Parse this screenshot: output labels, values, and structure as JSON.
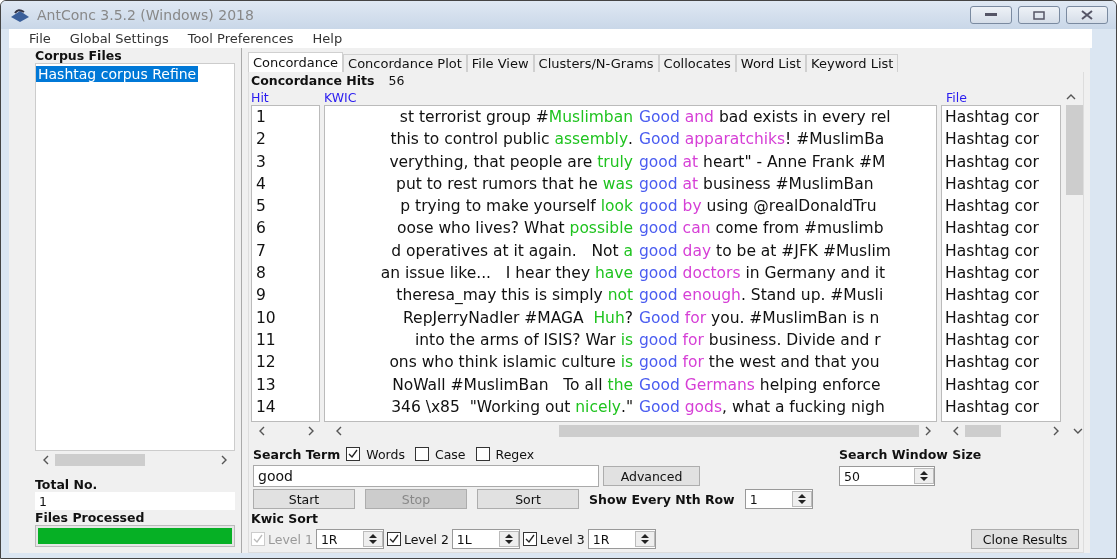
{
  "window": {
    "title": "AntConc 3.5.2 (Windows) 2018"
  },
  "menu": [
    "File",
    "Global Settings",
    "Tool Preferences",
    "Help"
  ],
  "corpus_files": {
    "label": "Corpus Files",
    "files": [
      {
        "name": "Hashtag corpus Refine",
        "selected": true
      }
    ]
  },
  "total_no": {
    "label": "Total No.",
    "value": "1"
  },
  "files_processed": {
    "label": "Files Processed",
    "level": 1
  },
  "tabs": [
    {
      "label": "Concordance",
      "selected": true
    },
    {
      "label": "Concordance Plot",
      "selected": false
    },
    {
      "label": "File View",
      "selected": false
    },
    {
      "label": "Clusters/N-Grams",
      "selected": false
    },
    {
      "label": "Collocates",
      "selected": false
    },
    {
      "label": "Word List",
      "selected": false
    },
    {
      "label": "Keyword List",
      "selected": false
    }
  ],
  "hits": {
    "label": "Concordance Hits",
    "value": "56"
  },
  "table": {
    "columns": [
      "Hit",
      "KWIC",
      "File"
    ],
    "rows": [
      {
        "hit": "1",
        "left": [
          {
            "kind": "plain",
            "text": "st terrorist group #"
          },
          {
            "kind": "collocate",
            "text": "Muslimban"
          }
        ],
        "node": "Good",
        "right": [
          {
            "kind": "collocate",
            "text": "and"
          },
          {
            "kind": "plain",
            "text": " bad exists in every rel"
          }
        ],
        "file": "Hashtag cor"
      },
      {
        "hit": "2",
        "left": [
          {
            "kind": "plain",
            "text": "this to control public "
          },
          {
            "kind": "collocate",
            "text": "assembly"
          },
          {
            "kind": "plain",
            "text": "."
          }
        ],
        "node": "Good",
        "right": [
          {
            "kind": "collocate",
            "text": "apparatchiks"
          },
          {
            "kind": "plain",
            "text": "! #MuslimBa"
          }
        ],
        "file": "Hashtag cor"
      },
      {
        "hit": "3",
        "left": [
          {
            "kind": "plain",
            "text": "verything, that people are "
          },
          {
            "kind": "collocate",
            "text": "truly"
          }
        ],
        "node": "good",
        "right": [
          {
            "kind": "collocate",
            "text": "at"
          },
          {
            "kind": "plain",
            "text": " heart\" - Anne Frank #M"
          }
        ],
        "file": "Hashtag cor"
      },
      {
        "hit": "4",
        "left": [
          {
            "kind": "plain",
            "text": "put to rest rumors that he "
          },
          {
            "kind": "collocate",
            "text": "was"
          }
        ],
        "node": "good",
        "right": [
          {
            "kind": "collocate",
            "text": "at"
          },
          {
            "kind": "plain",
            "text": " business #MuslimBan"
          }
        ],
        "file": "Hashtag cor"
      },
      {
        "hit": "5",
        "left": [
          {
            "kind": "plain",
            "text": "p trying to make yourself "
          },
          {
            "kind": "collocate",
            "text": "look"
          }
        ],
        "node": "good",
        "right": [
          {
            "kind": "collocate",
            "text": "by"
          },
          {
            "kind": "plain",
            "text": " using @realDonaldTru"
          }
        ],
        "file": "Hashtag cor"
      },
      {
        "hit": "6",
        "left": [
          {
            "kind": "plain",
            "text": "oose who lives? What "
          },
          {
            "kind": "collocate",
            "text": "possible"
          }
        ],
        "node": "good",
        "right": [
          {
            "kind": "collocate",
            "text": "can"
          },
          {
            "kind": "plain",
            "text": " come from #muslimb"
          }
        ],
        "file": "Hashtag cor"
      },
      {
        "hit": "7",
        "left": [
          {
            "kind": "plain",
            "text": "d operatives at it again.   Not "
          },
          {
            "kind": "collocate",
            "text": "a"
          }
        ],
        "node": "good",
        "right": [
          {
            "kind": "collocate",
            "text": "day"
          },
          {
            "kind": "plain",
            "text": " to be at #JFK #Muslim"
          }
        ],
        "file": "Hashtag cor"
      },
      {
        "hit": "8",
        "left": [
          {
            "kind": "plain",
            "text": "an issue like...   I hear they "
          },
          {
            "kind": "collocate",
            "text": "have"
          }
        ],
        "node": "good",
        "right": [
          {
            "kind": "collocate",
            "text": "doctors"
          },
          {
            "kind": "plain",
            "text": " in Germany and it"
          }
        ],
        "file": "Hashtag cor"
      },
      {
        "hit": "9",
        "left": [
          {
            "kind": "plain",
            "text": "theresa_may this is simply "
          },
          {
            "kind": "collocate",
            "text": "not"
          }
        ],
        "node": "good",
        "right": [
          {
            "kind": "collocate",
            "text": "enough"
          },
          {
            "kind": "plain",
            "text": ". Stand up. #Musli"
          }
        ],
        "file": "Hashtag cor"
      },
      {
        "hit": "10",
        "left": [
          {
            "kind": "plain",
            "text": "RepJerryNadler #MAGA  "
          },
          {
            "kind": "collocate",
            "text": "Huh"
          },
          {
            "kind": "plain",
            "text": "?"
          }
        ],
        "node": "Good",
        "right": [
          {
            "kind": "collocate",
            "text": "for"
          },
          {
            "kind": "plain",
            "text": " you. #MuslimBan is n"
          }
        ],
        "file": "Hashtag cor"
      },
      {
        "hit": "11",
        "left": [
          {
            "kind": "plain",
            "text": "into the arms of ISIS? War "
          },
          {
            "kind": "collocate",
            "text": "is"
          }
        ],
        "node": "good",
        "right": [
          {
            "kind": "collocate",
            "text": "for"
          },
          {
            "kind": "plain",
            "text": " business. Divide and r"
          }
        ],
        "file": "Hashtag cor"
      },
      {
        "hit": "12",
        "left": [
          {
            "kind": "plain",
            "text": "ons who think islamic culture "
          },
          {
            "kind": "collocate",
            "text": "is"
          }
        ],
        "node": "good",
        "right": [
          {
            "kind": "collocate",
            "text": "for"
          },
          {
            "kind": "plain",
            "text": " the west and that you"
          }
        ],
        "file": "Hashtag cor"
      },
      {
        "hit": "13",
        "left": [
          {
            "kind": "plain",
            "text": "NoWall #MuslimBan   To all "
          },
          {
            "kind": "collocate",
            "text": "the"
          }
        ],
        "node": "Good",
        "right": [
          {
            "kind": "collocate",
            "text": "Germans"
          },
          {
            "kind": "plain",
            "text": " helping enforce"
          }
        ],
        "file": "Hashtag cor"
      },
      {
        "hit": "14",
        "left": [
          {
            "kind": "plain",
            "text": "346 \\x85  \"Working out "
          },
          {
            "kind": "collocate",
            "text": "nicely"
          },
          {
            "kind": "plain",
            "text": ".\""
          }
        ],
        "node": "Good",
        "right": [
          {
            "kind": "collocate",
            "text": "gods"
          },
          {
            "kind": "plain",
            "text": ", what a fucking nigh"
          }
        ],
        "file": "Hashtag cor"
      }
    ]
  },
  "search": {
    "label": "Search Term",
    "options": [
      {
        "label": "Words",
        "checked": true
      },
      {
        "label": "Case",
        "checked": false
      },
      {
        "label": "Regex",
        "checked": false
      }
    ],
    "value": "good",
    "advanced": "Advanced"
  },
  "window_size": {
    "label": "Search Window Size",
    "value": "50"
  },
  "actions": [
    {
      "label": "Start",
      "disabled": false
    },
    {
      "label": "Stop",
      "disabled": true
    },
    {
      "label": "Sort",
      "disabled": false
    }
  ],
  "nth_row": {
    "label": "Show Every Nth Row",
    "value": "1"
  },
  "kwic_sort": {
    "label": "Kwic Sort",
    "levels": [
      {
        "label": "Level 1",
        "checked": true,
        "disabled": true,
        "value": "1R"
      },
      {
        "label": "Level 2",
        "checked": true,
        "disabled": false,
        "value": "1L"
      },
      {
        "label": "Level 3",
        "checked": true,
        "disabled": false,
        "value": "1R"
      }
    ]
  },
  "clone": "Clone Results"
}
